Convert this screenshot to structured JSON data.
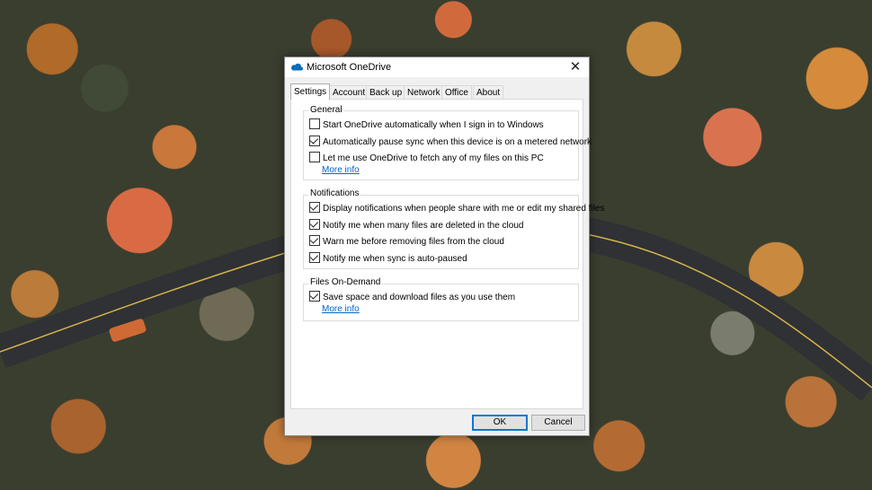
{
  "window": {
    "title": "Microsoft OneDrive",
    "icon": "onedrive-cloud-icon",
    "close_glyph": "✕"
  },
  "tabs": [
    "Settings",
    "Account",
    "Back up",
    "Network",
    "Office",
    "About"
  ],
  "active_tab": "Settings",
  "general": {
    "title": "General",
    "options": [
      {
        "label": "Start OneDrive automatically when I sign in to Windows",
        "checked": false
      },
      {
        "label": "Automatically pause sync when this device is on a metered network",
        "checked": true
      },
      {
        "label": "Let me use OneDrive to fetch any of my files on this PC",
        "checked": false
      }
    ],
    "more_info": "More info"
  },
  "notifications": {
    "title": "Notifications",
    "options": [
      {
        "label": "Display notifications when people share with me or edit my shared files",
        "checked": true
      },
      {
        "label": "Notify me when many files are deleted in the cloud",
        "checked": true
      },
      {
        "label": "Warn me before removing files from the cloud",
        "checked": true
      },
      {
        "label": "Notify me when sync is auto-paused",
        "checked": true
      }
    ]
  },
  "files_on_demand": {
    "title": "Files On-Demand",
    "options": [
      {
        "label": "Save space and download files as you use them",
        "checked": true
      }
    ],
    "more_info": "More info"
  },
  "buttons": {
    "ok": "OK",
    "cancel": "Cancel"
  },
  "colors": {
    "accent": "#0078d7",
    "link": "#0066cc",
    "onedrive_blue": "#0f6cbd"
  }
}
